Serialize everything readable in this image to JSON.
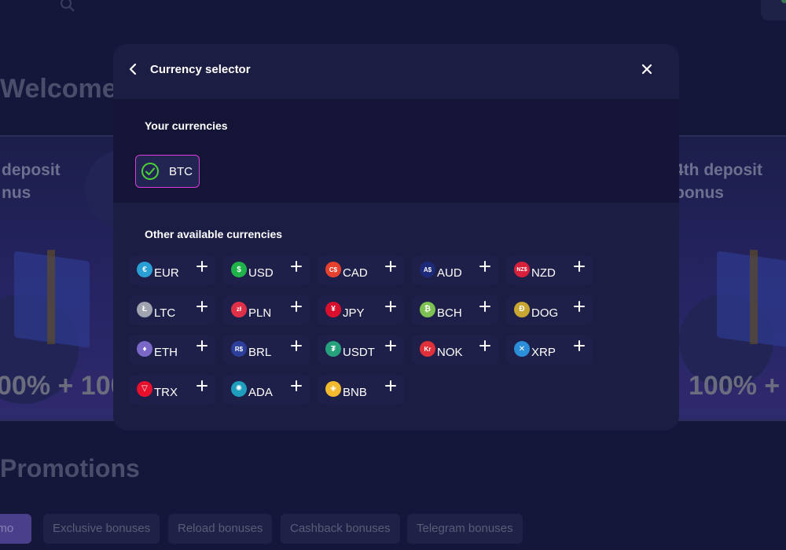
{
  "background": {
    "welcome_text": "Welcome",
    "left_card_text": "deposit\nnus",
    "right_card_text": "4th deposit\nbonus",
    "left_big_text": "00% + 100",
    "right_big_text": "100% +",
    "promotions_title": "Promotions",
    "promo_tabs": [
      "omo",
      "Exclusive bonuses",
      "Reload bonuses",
      "Cashback bonuses",
      "Telegram bonuses"
    ]
  },
  "modal": {
    "title": "Currency selector",
    "back_icon": "chevron-left-icon",
    "close_icon": "close-icon",
    "your_currencies": {
      "title": "Your currencies",
      "items": [
        {
          "code": "BTC",
          "icon": "check-circle-icon",
          "color": "#4cd137"
        }
      ]
    },
    "other_currencies": {
      "title": "Other available currencies",
      "items": [
        {
          "code": "EUR",
          "glyph": "€",
          "color": "#2a9fd6"
        },
        {
          "code": "USD",
          "glyph": "$",
          "color": "#1fb34a"
        },
        {
          "code": "CAD",
          "glyph": "C$",
          "color": "#e8402f"
        },
        {
          "code": "AUD",
          "glyph": "A$",
          "color": "#1d2a7a"
        },
        {
          "code": "NZD",
          "glyph": "NZ$",
          "color": "#d8203a"
        },
        {
          "code": "LTC",
          "glyph": "Ł",
          "color": "#a0a4b0"
        },
        {
          "code": "PLN",
          "glyph": "zł",
          "color": "#e03048"
        },
        {
          "code": "JPY",
          "glyph": "¥",
          "color": "#d8102e"
        },
        {
          "code": "BCH",
          "glyph": "₿",
          "color": "#7cc152"
        },
        {
          "code": "DOG",
          "glyph": "Ð",
          "color": "#c9a632"
        },
        {
          "code": "ETH",
          "glyph": "♦",
          "color": "#7a68c9"
        },
        {
          "code": "BRL",
          "glyph": "R$",
          "color": "#2a3e9a"
        },
        {
          "code": "USDT",
          "glyph": "₮",
          "color": "#26a17b"
        },
        {
          "code": "NOK",
          "glyph": "Kr",
          "color": "#e0303a"
        },
        {
          "code": "XRP",
          "glyph": "✕",
          "color": "#2a8fd8"
        },
        {
          "code": "TRX",
          "glyph": "▽",
          "color": "#e8112d"
        },
        {
          "code": "ADA",
          "glyph": "✺",
          "color": "#1e9dbc"
        },
        {
          "code": "BNB",
          "glyph": "◈",
          "color": "#f3ba2f"
        }
      ]
    }
  }
}
